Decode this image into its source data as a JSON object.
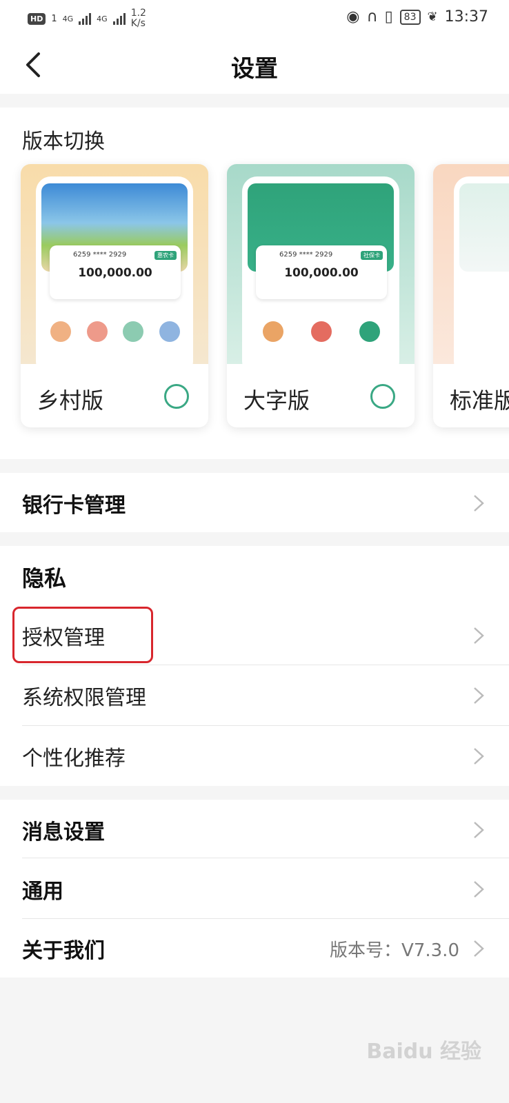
{
  "status_bar": {
    "hd_label": "HD",
    "sim_label": "1",
    "net1": "4G",
    "net2": "4G",
    "speed_value": "1.2",
    "speed_unit": "K/s",
    "battery": "83",
    "time": "13:37"
  },
  "nav": {
    "title": "设置"
  },
  "version_switch": {
    "title": "版本切换",
    "cards": [
      {
        "label": "乡村版",
        "selected": false,
        "card_number": "6259 **** 2929",
        "balance": "100,000.00",
        "tag": "惠农卡",
        "theme": "#f6d9a8"
      },
      {
        "label": "大字版",
        "selected": false,
        "card_number": "6259 **** 2929",
        "balance": "100,000.00",
        "tag": "社保卡",
        "theme": "#2fa37a"
      },
      {
        "label": "标准版",
        "selected": false,
        "card_number": "",
        "balance": "",
        "tag": "",
        "theme": "#f8dcc8"
      }
    ]
  },
  "bank_card": {
    "label": "银行卡管理"
  },
  "privacy": {
    "title": "隐私",
    "items": [
      {
        "label": "授权管理",
        "highlighted": true
      },
      {
        "label": "系统权限管理"
      },
      {
        "label": "个性化推荐"
      }
    ]
  },
  "misc": {
    "items": [
      {
        "label": "消息设置",
        "value": ""
      },
      {
        "label": "通用",
        "value": ""
      },
      {
        "label": "关于我们",
        "value": "版本号：V7.3.0"
      }
    ]
  },
  "watermark": "Baidu 经验",
  "colors": {
    "accent": "#3aa884",
    "highlight_border": "#d8262d",
    "background": "#f5f5f5"
  }
}
